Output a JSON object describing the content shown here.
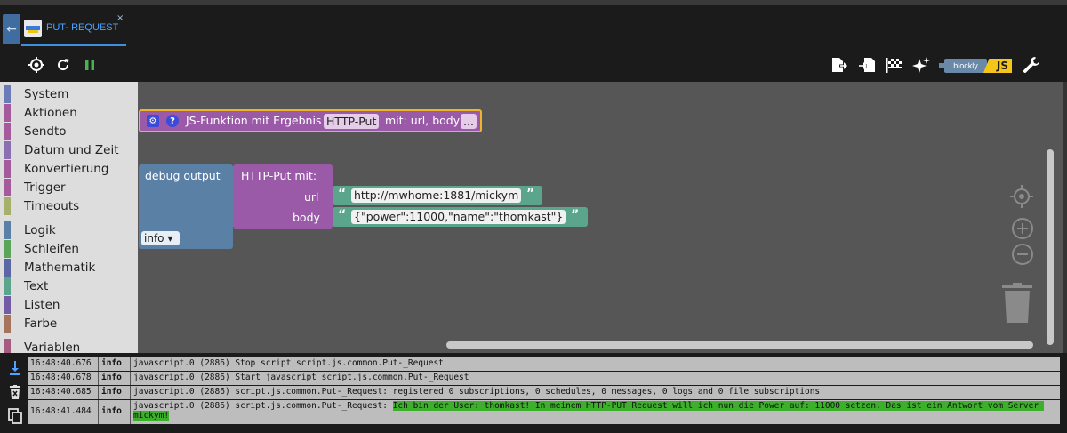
{
  "window": {
    "tab_label": "PUT- REQUEST",
    "tab_close": "×",
    "back_glyph": "←"
  },
  "toolbar": {
    "left_icons": [
      "target-icon",
      "refresh-icon",
      "pause-icon"
    ],
    "right_icons": [
      "export-icon",
      "import-icon",
      "checkered-flag-icon",
      "sparkle-icon",
      "wrench-icon"
    ],
    "blockly_label": "blockly",
    "js_label": "JS",
    "pause_color": "#4caf50"
  },
  "sidebar": {
    "categories": [
      {
        "label": "System",
        "color": "#6b7bb8"
      },
      {
        "label": "Aktionen",
        "color": "#a65a9e"
      },
      {
        "label": "Sendto",
        "color": "#a65a9e"
      },
      {
        "label": "Datum und Zeit",
        "color": "#8b6fb0"
      },
      {
        "label": "Konvertierung",
        "color": "#a65a9e"
      },
      {
        "label": "Trigger",
        "color": "#a65a9e"
      },
      {
        "label": "Timeouts",
        "color": "#a6b06a"
      },
      {
        "label": "Logik",
        "color": "#5b80a5"
      },
      {
        "label": "Schleifen",
        "color": "#5ba55b"
      },
      {
        "label": "Mathematik",
        "color": "#5b67a5"
      },
      {
        "label": "Text",
        "color": "#5ba58c"
      },
      {
        "label": "Listen",
        "color": "#745ba5"
      },
      {
        "label": "Farbe",
        "color": "#a5745b"
      },
      {
        "label": "Variablen",
        "color": "#a55b80"
      }
    ]
  },
  "workspace": {
    "function_block": {
      "prefix": "JS-Funktion mit Ergebnis",
      "name": "HTTP-Put",
      "suffix": "mit: url, body",
      "more": "...",
      "gear_glyph": "⚙",
      "help_glyph": "?"
    },
    "debug_block": {
      "label": "debug output",
      "level": "info ▾"
    },
    "call_block": {
      "label": "HTTP-Put  mit:",
      "arg1": "url",
      "arg2": "body"
    },
    "url_value": "http://mwhome:1881/mickym",
    "body_value": "{\"power\":11000,\"name\":\"thomkast\"}",
    "open_quote": "“",
    "close_quote": "”"
  },
  "log": {
    "side_icons": [
      "scroll-down-icon",
      "clear-log-icon",
      "copy-icon"
    ],
    "rows": [
      {
        "time": "16:48:40.676",
        "level": "info",
        "message": "javascript.0 (2886) Stop script script.js.common.Put-_Request",
        "highlight": ""
      },
      {
        "time": "16:48:40.678",
        "level": "info",
        "message": "javascript.0 (2886) Start javascript script.js.common.Put-_Request",
        "highlight": ""
      },
      {
        "time": "16:48:40.685",
        "level": "info",
        "message": "javascript.0 (2886) script.js.common.Put-_Request: registered 0 subscriptions, 0 schedules, 0 messages, 0 logs and 0 file subscriptions",
        "highlight": ""
      },
      {
        "time": "16:48:41.484",
        "level": "info",
        "message": "javascript.0 (2886) script.js.common.Put-_Request: ",
        "highlight": "Ich bin der User: thomkast! In meinem HTTP-PUT Request will ich nun die Power auf: 11000 setzen. Das ist ein Antwort vom Server mickym!"
      }
    ]
  }
}
